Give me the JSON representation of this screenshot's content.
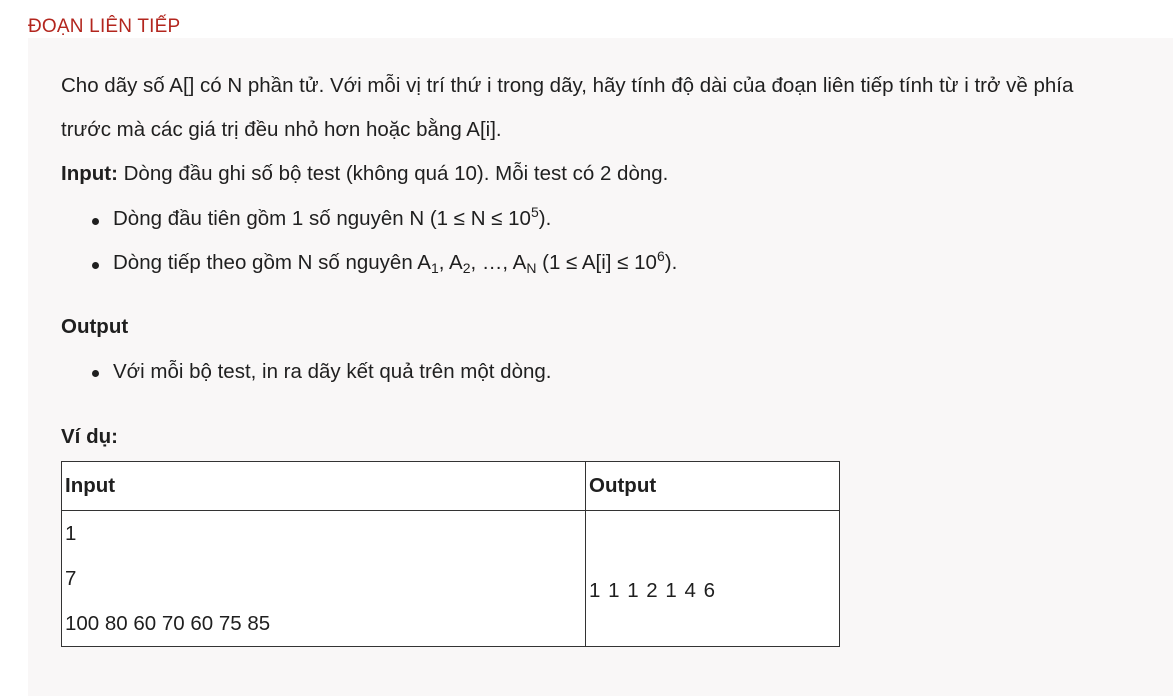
{
  "problem": {
    "title": "ĐOẠN LIÊN TIẾP",
    "description_line1": "Cho dãy số A[] có N phần tử. Với mỗi vị trí thứ i trong dãy, hãy tính độ dài của đoạn liên tiếp tính từ i trở về phía",
    "description_line2": "trước mà các giá trị đều nhỏ hơn hoặc bằng A[i].",
    "input_label": "Input:",
    "input_text": " Dòng đầu ghi số bộ test (không quá 10). Mỗi test có 2 dòng.",
    "input_bullets": {
      "b1_prefix": "Dòng đầu tiên gồm 1 số nguyên N (1 ≤ N ≤ 10",
      "b1_sup": "5",
      "b1_suffix": ").",
      "b2_prefix": "Dòng tiếp theo gồm N số nguyên A",
      "b2_sub1": "1",
      "b2_mid1": ", A",
      "b2_sub2": "2",
      "b2_mid2": ", …, A",
      "b2_sub3": "N",
      "b2_mid3": " (1 ≤ A[i] ≤ 10",
      "b2_sup": "6",
      "b2_suffix": ")."
    },
    "output_label": "Output",
    "output_bullet": "Với mỗi bộ test, in ra dãy kết quả trên một dòng.",
    "example_label": "Ví dụ:",
    "example_table": {
      "headers": [
        "Input",
        "Output"
      ],
      "input_lines": [
        "1",
        "7",
        "100 80 60 70 60 75 85"
      ],
      "output_value": "1 1 1 2 1 4 6"
    }
  }
}
